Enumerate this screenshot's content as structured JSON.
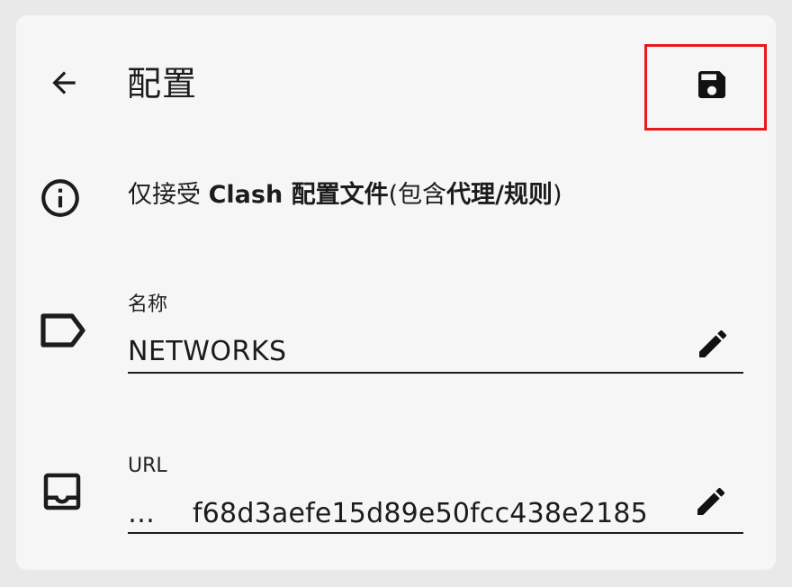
{
  "header": {
    "title": "配置",
    "back_icon": "arrow-left-icon",
    "save_icon": "floppy-disk-icon"
  },
  "info": {
    "icon": "info-circle-icon",
    "prefix": "仅接受 ",
    "bold1": "Clash 配置文件",
    "middle": "(包含",
    "bold2": "代理/规则",
    "suffix": ")"
  },
  "fields": {
    "name": {
      "icon": "label-tag-icon",
      "caption": "名称",
      "value": "NETWORKS",
      "edit_icon": "pencil-edit-icon"
    },
    "url": {
      "icon": "inbox-tray-icon",
      "caption": "URL",
      "prefix": "…",
      "value": "f68d3aefe15d89e50fcc438e2185",
      "edit_icon": "pencil-edit-icon"
    }
  },
  "colors": {
    "background": "#f6f6f6",
    "text": "#1c1c1c",
    "highlight_box": "#e6191e"
  }
}
